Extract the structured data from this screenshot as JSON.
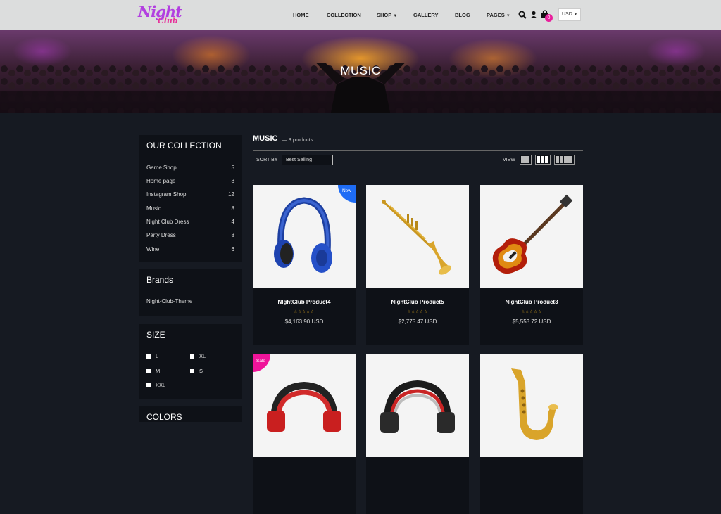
{
  "header": {
    "logo_line1": "Night",
    "logo_line2": "Club",
    "nav": [
      "HOME",
      "COLLECTION",
      "SHOP",
      "GALLERY",
      "BLOG",
      "PAGES"
    ],
    "cart_count": "0",
    "currency": "USD"
  },
  "hero": {
    "title": "MUSIC"
  },
  "sidebar": {
    "collection_title": "OUR COLLECTION",
    "collections": [
      {
        "label": "Game Shop",
        "count": "5"
      },
      {
        "label": "Home page",
        "count": "8"
      },
      {
        "label": "Instagram Shop",
        "count": "12"
      },
      {
        "label": "Music",
        "count": "8"
      },
      {
        "label": "Night Club Dress",
        "count": "4"
      },
      {
        "label": "Party Dress",
        "count": "8"
      },
      {
        "label": "Wine",
        "count": "6"
      }
    ],
    "brands_title": "Brands",
    "brands": [
      "Night-Club-Theme"
    ],
    "size_title": "SIZE",
    "sizes": [
      "L",
      "XL",
      "M",
      "S",
      "XXL"
    ],
    "colors_title": "COLORS"
  },
  "main": {
    "title": "MUSIC",
    "count_text": "— 8 products",
    "sort_label": "SORT BY",
    "sort_value": "Best Selling",
    "view_label": "VIEW"
  },
  "products": [
    {
      "name": "NIghtClub Product4",
      "price": "$4,163.90 USD",
      "badge": "New",
      "image": "headphones-blue"
    },
    {
      "name": "NIghtClub Product5",
      "price": "$2,775.47 USD",
      "badge": "",
      "image": "trumpet"
    },
    {
      "name": "NIghtClub Product3",
      "price": "$5,553.72 USD",
      "badge": "",
      "image": "bass-guitar"
    },
    {
      "name": "",
      "price": "",
      "badge": "Sale",
      "image": "headphones-red"
    },
    {
      "name": "",
      "price": "",
      "badge": "",
      "image": "headphones-silver"
    },
    {
      "name": "",
      "price": "",
      "badge": "",
      "image": "saxophone"
    }
  ],
  "stars_glyph": "☆☆☆☆☆",
  "colors": {
    "badge_new": "#1e6cf5",
    "badge_sale": "#f0149a",
    "star": "#d8a31c"
  }
}
